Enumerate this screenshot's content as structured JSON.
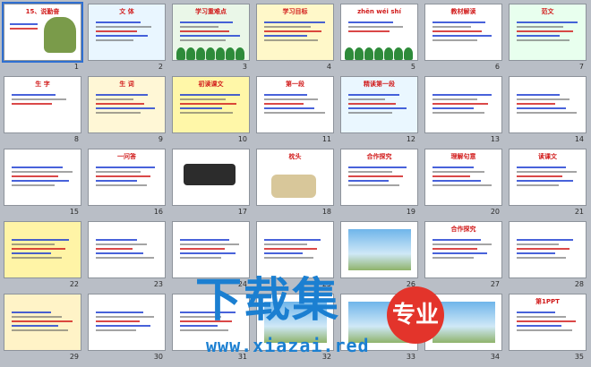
{
  "colors": {
    "background": "#b9bec6",
    "watermark": "#1b7fd1",
    "badge": "#e3342b",
    "selection": "#2f6fd1"
  },
  "slides": [
    {
      "number": "1",
      "title": "15、说勤奋",
      "kind": "title",
      "bg": "#ffffff"
    },
    {
      "number": "2",
      "title": "文  体",
      "kind": "text",
      "bg": "#e9f6ff"
    },
    {
      "number": "3",
      "title": "学习重难点",
      "kind": "text",
      "bg": "#eaf7e8"
    },
    {
      "number": "4",
      "title": "学习目标",
      "kind": "text",
      "bg": "#fff8c9"
    },
    {
      "number": "5",
      "title": "zhēn  wéi  shí",
      "kind": "pinyin",
      "bg": "#ffffff"
    },
    {
      "number": "6",
      "title": "教材解读",
      "kind": "text",
      "bg": "#ffffff"
    },
    {
      "number": "7",
      "title": "范文",
      "kind": "text",
      "bg": "#e8ffee"
    },
    {
      "number": "8",
      "title": "生 字",
      "kind": "pinyin",
      "bg": "#ffffff"
    },
    {
      "number": "9",
      "title": "生 词",
      "kind": "text",
      "bg": "#fff7d6"
    },
    {
      "number": "10",
      "title": "初读课文",
      "kind": "text",
      "bg": "#fff7a8"
    },
    {
      "number": "11",
      "title": "第一段",
      "kind": "text",
      "bg": "#ffffff"
    },
    {
      "number": "12",
      "title": "精读第一段",
      "kind": "text",
      "bg": "#eaf7ff"
    },
    {
      "number": "13",
      "title": "",
      "kind": "text",
      "bg": "#ffffff"
    },
    {
      "number": "14",
      "title": "",
      "kind": "text",
      "bg": "#ffffff"
    },
    {
      "number": "15",
      "title": "",
      "kind": "text",
      "bg": "#ffffff"
    },
    {
      "number": "16",
      "title": "一问答",
      "kind": "text",
      "bg": "#ffffff"
    },
    {
      "number": "17",
      "title": "",
      "kind": "object",
      "bg": "#ffffff"
    },
    {
      "number": "18",
      "title": "枕头",
      "kind": "object",
      "bg": "#ffffff"
    },
    {
      "number": "19",
      "title": "合作探究",
      "kind": "text",
      "bg": "#ffffff"
    },
    {
      "number": "20",
      "title": "理解句意",
      "kind": "text",
      "bg": "#ffffff"
    },
    {
      "number": "21",
      "title": "读课文",
      "kind": "text",
      "bg": "#ffffff"
    },
    {
      "number": "22",
      "title": "",
      "kind": "text",
      "bg": "#fff4a6"
    },
    {
      "number": "23",
      "title": "",
      "kind": "text",
      "bg": "#ffffff"
    },
    {
      "number": "24",
      "title": "",
      "kind": "text",
      "bg": "#ffffff"
    },
    {
      "number": "25",
      "title": "",
      "kind": "text",
      "bg": "#ffffff"
    },
    {
      "number": "26",
      "title": "",
      "kind": "photo",
      "bg": "#ffffff"
    },
    {
      "number": "27",
      "title": "合作探究",
      "kind": "text",
      "bg": "#ffffff"
    },
    {
      "number": "28",
      "title": "",
      "kind": "text",
      "bg": "#ffffff"
    },
    {
      "number": "29",
      "title": "",
      "kind": "text",
      "bg": "#fff3c7"
    },
    {
      "number": "30",
      "title": "",
      "kind": "text",
      "bg": "#ffffff"
    },
    {
      "number": "31",
      "title": "",
      "kind": "text",
      "bg": "#ffffff"
    },
    {
      "number": "32",
      "title": "",
      "kind": "photo",
      "bg": "#ffffff"
    },
    {
      "number": "33",
      "title": "",
      "kind": "photo",
      "bg": "#ffffff"
    },
    {
      "number": "34",
      "title": "",
      "kind": "photo",
      "bg": "#ffffff"
    },
    {
      "number": "35",
      "title": "第1PPT",
      "kind": "text",
      "bg": "#ffffff"
    }
  ],
  "watermark": {
    "text": "下载集",
    "badge": "专业",
    "url": "www.xiazai.red"
  }
}
